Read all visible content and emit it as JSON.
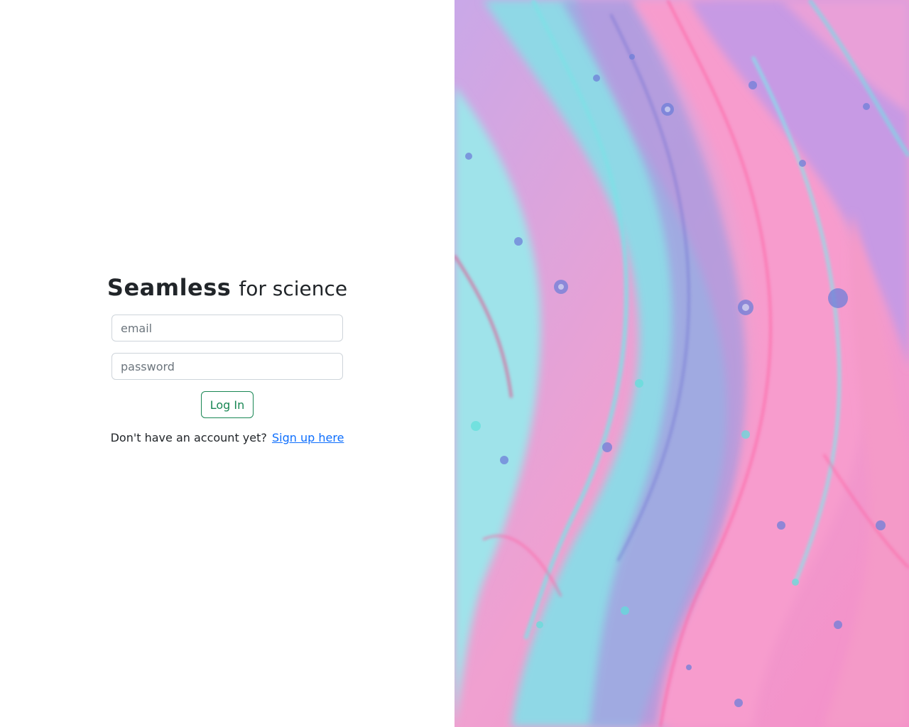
{
  "brand": {
    "name": "Seamless",
    "tagline": "for science"
  },
  "form": {
    "email_placeholder": "email",
    "password_placeholder": "password",
    "login_label": "Log In"
  },
  "signup": {
    "prompt": "Don't have an account yet?",
    "link_label": "Sign up here"
  },
  "colors": {
    "primary_success": "#198754",
    "link": "#0d6efd",
    "art_pink": "#f48fc8",
    "art_cyan": "#8fe0e8",
    "art_violet": "#a98fe0"
  },
  "hero_image": "abstract-fluid-art"
}
